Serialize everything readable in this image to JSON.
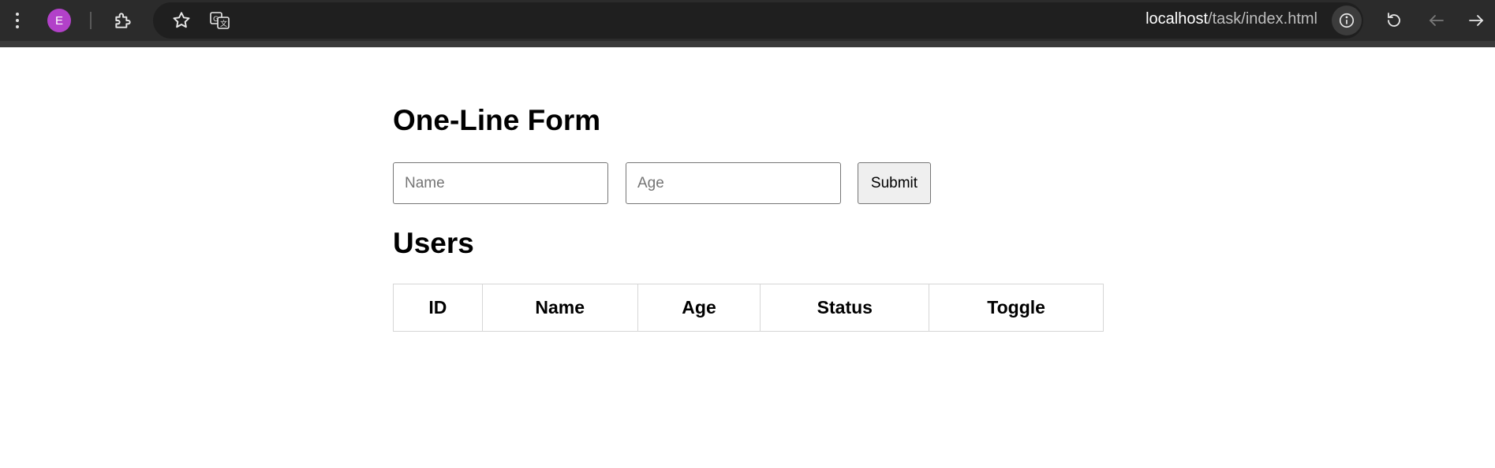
{
  "browser": {
    "avatar_letter": "E",
    "url_host": "localhost",
    "url_path": "/task/index.html",
    "icons": [
      "menu-icon",
      "extensions-icon",
      "bookmark-star-icon",
      "translate-icon",
      "site-info-icon",
      "reload-icon",
      "back-arrow-icon",
      "forward-arrow-icon"
    ],
    "avatar_color": "#b241c9"
  },
  "form": {
    "heading": "One-Line Form",
    "name_placeholder": "Name",
    "age_placeholder": "Age",
    "submit_label": "Submit"
  },
  "users": {
    "heading": "Users",
    "columns": [
      "ID",
      "Name",
      "Age",
      "Status",
      "Toggle"
    ],
    "rows": []
  }
}
